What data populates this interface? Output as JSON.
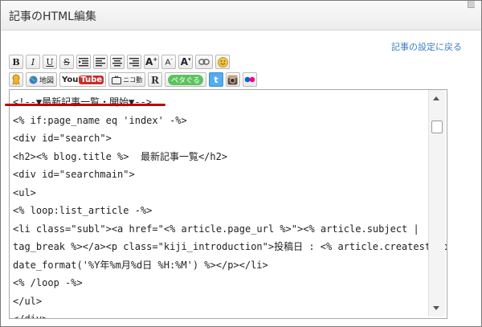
{
  "window": {
    "title": "記事のHTML編集"
  },
  "header": {
    "settings_link": "記事の設定に戻る"
  },
  "toolbar": {
    "row1": [
      {
        "name": "bold-button",
        "label": "B",
        "icon": "bold-icon"
      },
      {
        "name": "italic-button",
        "label": "I",
        "icon": "italic-icon"
      },
      {
        "name": "underline-button",
        "label": "U",
        "icon": "underline-icon"
      },
      {
        "name": "strikethrough-button",
        "label": "S",
        "icon": "strikethrough-icon"
      },
      {
        "name": "indent-button",
        "icon": "indent-icon"
      },
      {
        "name": "align-left-button",
        "icon": "align-left-icon"
      },
      {
        "name": "align-center-button",
        "icon": "align-center-icon"
      },
      {
        "name": "align-right-button",
        "icon": "align-right-icon"
      },
      {
        "name": "font-size-up-button",
        "label": "A",
        "icon": "font-size-up-icon"
      },
      {
        "name": "font-size-down-button",
        "label": "A",
        "icon": "font-size-down-icon"
      },
      {
        "name": "font-color-button",
        "label": "A",
        "icon": "font-color-icon"
      },
      {
        "name": "link-button",
        "icon": "link-icon"
      },
      {
        "name": "emoji-button",
        "icon": "smiley-icon"
      }
    ],
    "row2": {
      "badge_icon": "ribbon-icon",
      "map_label": "地図",
      "youtube_you": "You",
      "youtube_tube": "Tube",
      "niconico_label": "ニコ動",
      "r_icon": "r-icon",
      "petabo_label": "ペタぐる",
      "twitter_label": "t",
      "instagram_icon": "instagram-icon",
      "flickr_icon": "flickr-icon"
    }
  },
  "editor": {
    "lines": [
      "<!--▼最新記事一覧・開始▼-->",
      "<% if:page_name eq 'index' -%>",
      "<div id=\"search\">",
      "<h2><% blog.title %>  最新記事一覧</h2>",
      "<div id=\"searchmain\">",
      "<ul>",
      "<% loop:list_article -%>",
      "<li class=\"subl\"><a href=\"<% article.page_url %>\"><% article.subject |",
      "tag_break %></a><p class=\"kiji_introduction\">投稿日 : <% article.createstamp |",
      "date_format('%Y年%m月%d日 %H:%M') %></p></li>",
      "<% /loop -%>",
      "</ul>",
      "</div>"
    ]
  },
  "colors": {
    "link": "#3b7fc4",
    "underline_mark": "#c00000",
    "youtube_red": "#c4302b"
  }
}
